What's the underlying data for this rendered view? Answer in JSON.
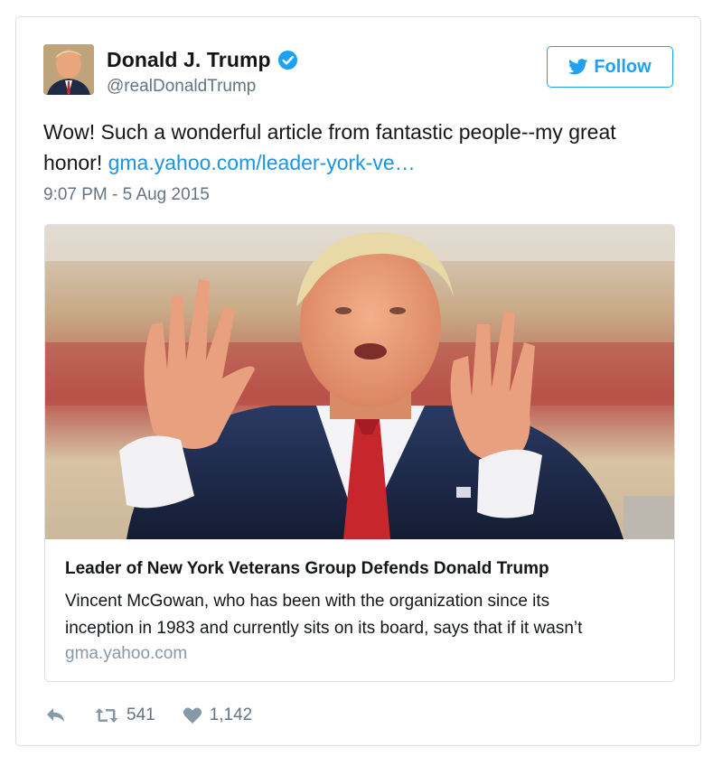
{
  "colors": {
    "accent": "#1da1f2",
    "link": "#1b95e0",
    "verified": "#1da1f2",
    "secondary_text": "#66757f",
    "border": "#d9dfe4"
  },
  "author": {
    "display_name": "Donald J. Trump",
    "handle": "@realDonaldTrump",
    "verified": true,
    "avatar_icon": "profile-photo"
  },
  "follow_button": {
    "label": "Follow",
    "icon": "twitter-bird-icon"
  },
  "tweet": {
    "text": "Wow! Such a wonderful article from fantastic people--my great honor! ",
    "link_text": "gma.yahoo.com/leader-york-ve…",
    "timestamp": "9:07 PM - 5 Aug 2015"
  },
  "link_card": {
    "image_alt": "photo of a man in suit with raised hands",
    "title": "Leader of New York Veterans Group Defends Donald Trump",
    "description_line1": "Vincent McGowan, who has been with the organization since its",
    "description_line2": "inception in 1983 and currently sits on its board, says that if it wasn’t",
    "domain": "gma.yahoo.com"
  },
  "actions": {
    "reply_icon": "reply-icon",
    "retweet_icon": "retweet-icon",
    "retweet_count": "541",
    "like_icon": "heart-icon",
    "like_count": "1,142"
  }
}
